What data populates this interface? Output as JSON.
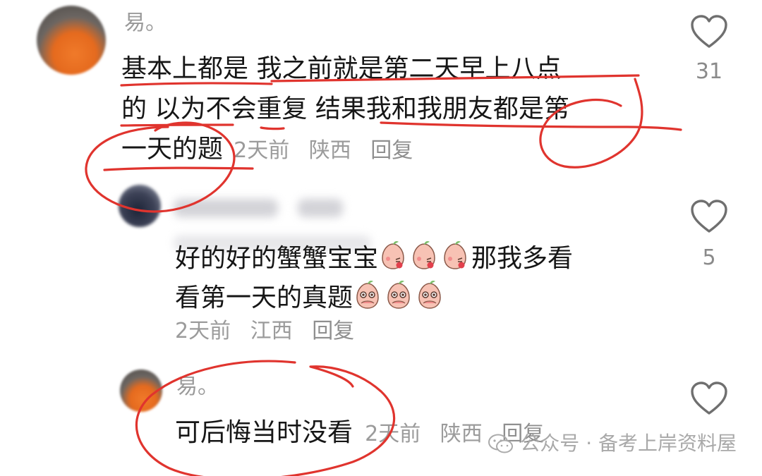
{
  "comments": [
    {
      "username": "易。",
      "lines": [
        "基本上都是 我之前就是第二天早上八点",
        "的 以为不会重复 结果我和我朋友都是第",
        "一天的题"
      ],
      "time": "2天前",
      "location": "陕西",
      "reply_label": "回复",
      "likes": "31"
    },
    {
      "username": "",
      "line1_text": "好的好的蟹蟹宝宝",
      "line1_tail": "那我多看",
      "line2_text": "看第一天的真题",
      "time": "2天前",
      "location": "江西",
      "reply_label": "回复",
      "likes": "5"
    },
    {
      "username": "易。",
      "lines": [
        "可后悔当时没看"
      ],
      "time": "2天前",
      "location": "陕西",
      "reply_label": "回复"
    }
  ],
  "watermark": {
    "text": "公众号 · 备考上岸资料屋",
    "icon": "wechat-icon"
  },
  "icons": {
    "like": "heart-outline-icon",
    "emoji": "peach-emoji-icon"
  },
  "annotation_color": "#e0342e"
}
